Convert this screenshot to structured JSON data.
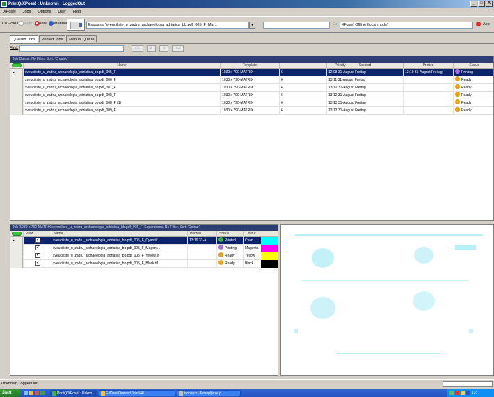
{
  "window": {
    "title": "PrintQ/XPose! : Unknown : LoggedOut",
    "controls": [
      "_",
      "□",
      "X"
    ]
  },
  "menu": [
    "XPose!",
    "Jobs",
    "Options",
    "User",
    "Help"
  ],
  "toolbar": {
    "device": "L10-2983:",
    "modes": [
      "Auto",
      "Idle",
      "Manual"
    ],
    "exposing_text": "Exposing 'sveuciliste_u_zadru_archaeologia_adriatica_bb.pdf_005_F_Ma…",
    "go_label": "Go",
    "status_field": "XPose! Offline (local mode)",
    "abort_label": "Abo"
  },
  "tabs": [
    "Queued Jobs",
    "Printed Jobs",
    "Manual Queue"
  ],
  "find": {
    "label": "Find:",
    "nav": [
      "<<",
      "<",
      ">",
      ">>"
    ]
  },
  "job_queue": {
    "group_caption": "Job Queue, No Filter, Sort: 'Created'",
    "columns": [
      "Name",
      "Template",
      "Priority",
      "Created",
      "Printed",
      "Status"
    ],
    "rows": [
      {
        "name": "sveuciliste_u_zadru_archaeologia_adriatica_bb.pdf_005_F",
        "template": "1030 x 790-MATRIX",
        "priority": "6",
        "created": "12:08 31-August Freitag",
        "printed": "13:19 31-August Freitag",
        "status": "Printing",
        "status_color": "#a070e0",
        "selected": true
      },
      {
        "name": "sveuciliste_u_zadru_archaeologia_adriatica_bb.pdf_006_F",
        "template": "1030 x 790-MATRIX",
        "priority": "6",
        "created": "13:11 31-August Freitag",
        "printed": "",
        "status": "Ready",
        "status_color": "#e8a020"
      },
      {
        "name": "sveuciliste_u_zadru_archaeologia_adriatica_bb.pdf_007_F",
        "template": "1030 x 790-MATRIX",
        "priority": "6",
        "created": "13:12 31-August Freitag",
        "printed": "",
        "status": "Ready",
        "status_color": "#e8a020"
      },
      {
        "name": "sveuciliste_u_zadru_archaeologia_adriatica_bb.pdf_008_F",
        "template": "1030 x 790-MATRIX",
        "priority": "6",
        "created": "13:12 31-August Freitag",
        "printed": "",
        "status": "Ready",
        "status_color": "#e8a020"
      },
      {
        "name": "sveuciliste_u_zadru_archaeologia_adriatica_bb.pdf_008_F (1)",
        "template": "1030 x 790-MATRIX",
        "priority": "6",
        "created": "13:13 31-August Freitag",
        "printed": "",
        "status": "Ready",
        "status_color": "#e8a020"
      },
      {
        "name": "sveuciliste_u_zadru_archaeologia_adriatica_bb.pdf_009_F",
        "template": "1030 x 790-MATRIX",
        "priority": "6",
        "created": "13:13 31-August Freitag",
        "printed": "",
        "status": "Ready",
        "status_color": "#e8a020"
      }
    ]
  },
  "separations": {
    "group_caption": "Job '1030 x 790-MATRIX'sveuciliste_u_zadru_archaeologia_adriatica_bb.pdf_005_F' Separations, No Filter, Sort: 'Colour'",
    "columns": [
      "Print",
      "Name",
      "Printed",
      "Status",
      "Colour"
    ],
    "rows": [
      {
        "print": "✓",
        "name": "sveuciliste_u_zadru_archaeologia_adriatica_bb.pdf_005_F_Cyan.tif",
        "printed": "13:19 31-A...",
        "status": "Printed",
        "status_color": "#40b040",
        "colour": "Cyan",
        "swatch": "#00ffff",
        "selected": true
      },
      {
        "print": "✓",
        "name": "sveuciliste_u_zadru_archaeologia_adriatica_bb.pdf_005_F_Magent...",
        "printed": "",
        "status": "Printing",
        "status_color": "#a070e0",
        "colour": "Magenta",
        "swatch": "#ff00ff"
      },
      {
        "print": "✓",
        "name": "sveuciliste_u_zadru_archaeologia_adriatica_bb.pdf_005_F_Yellow.tif",
        "printed": "",
        "status": "Ready",
        "status_color": "#e8a020",
        "colour": "Yellow",
        "swatch": "#ffff00"
      },
      {
        "print": "✓",
        "name": "sveuciliste_u_zadru_archaeologia_adriatica_bb.pdf_005_F_Black.tif",
        "printed": "",
        "status": "Ready",
        "status_color": "#e8a020",
        "colour": "Black",
        "swatch": "#000000"
      }
    ]
  },
  "statusbar": {
    "text": "Unknown LoggedOut"
  },
  "taskbar": {
    "start": "Start",
    "items": [
      "PrintQ/XPose! : Unkno...",
      "E:\\Data\\Queued Jobs\\48...",
      "Monarch - Prikupljanje p..."
    ],
    "clock": "13:"
  }
}
